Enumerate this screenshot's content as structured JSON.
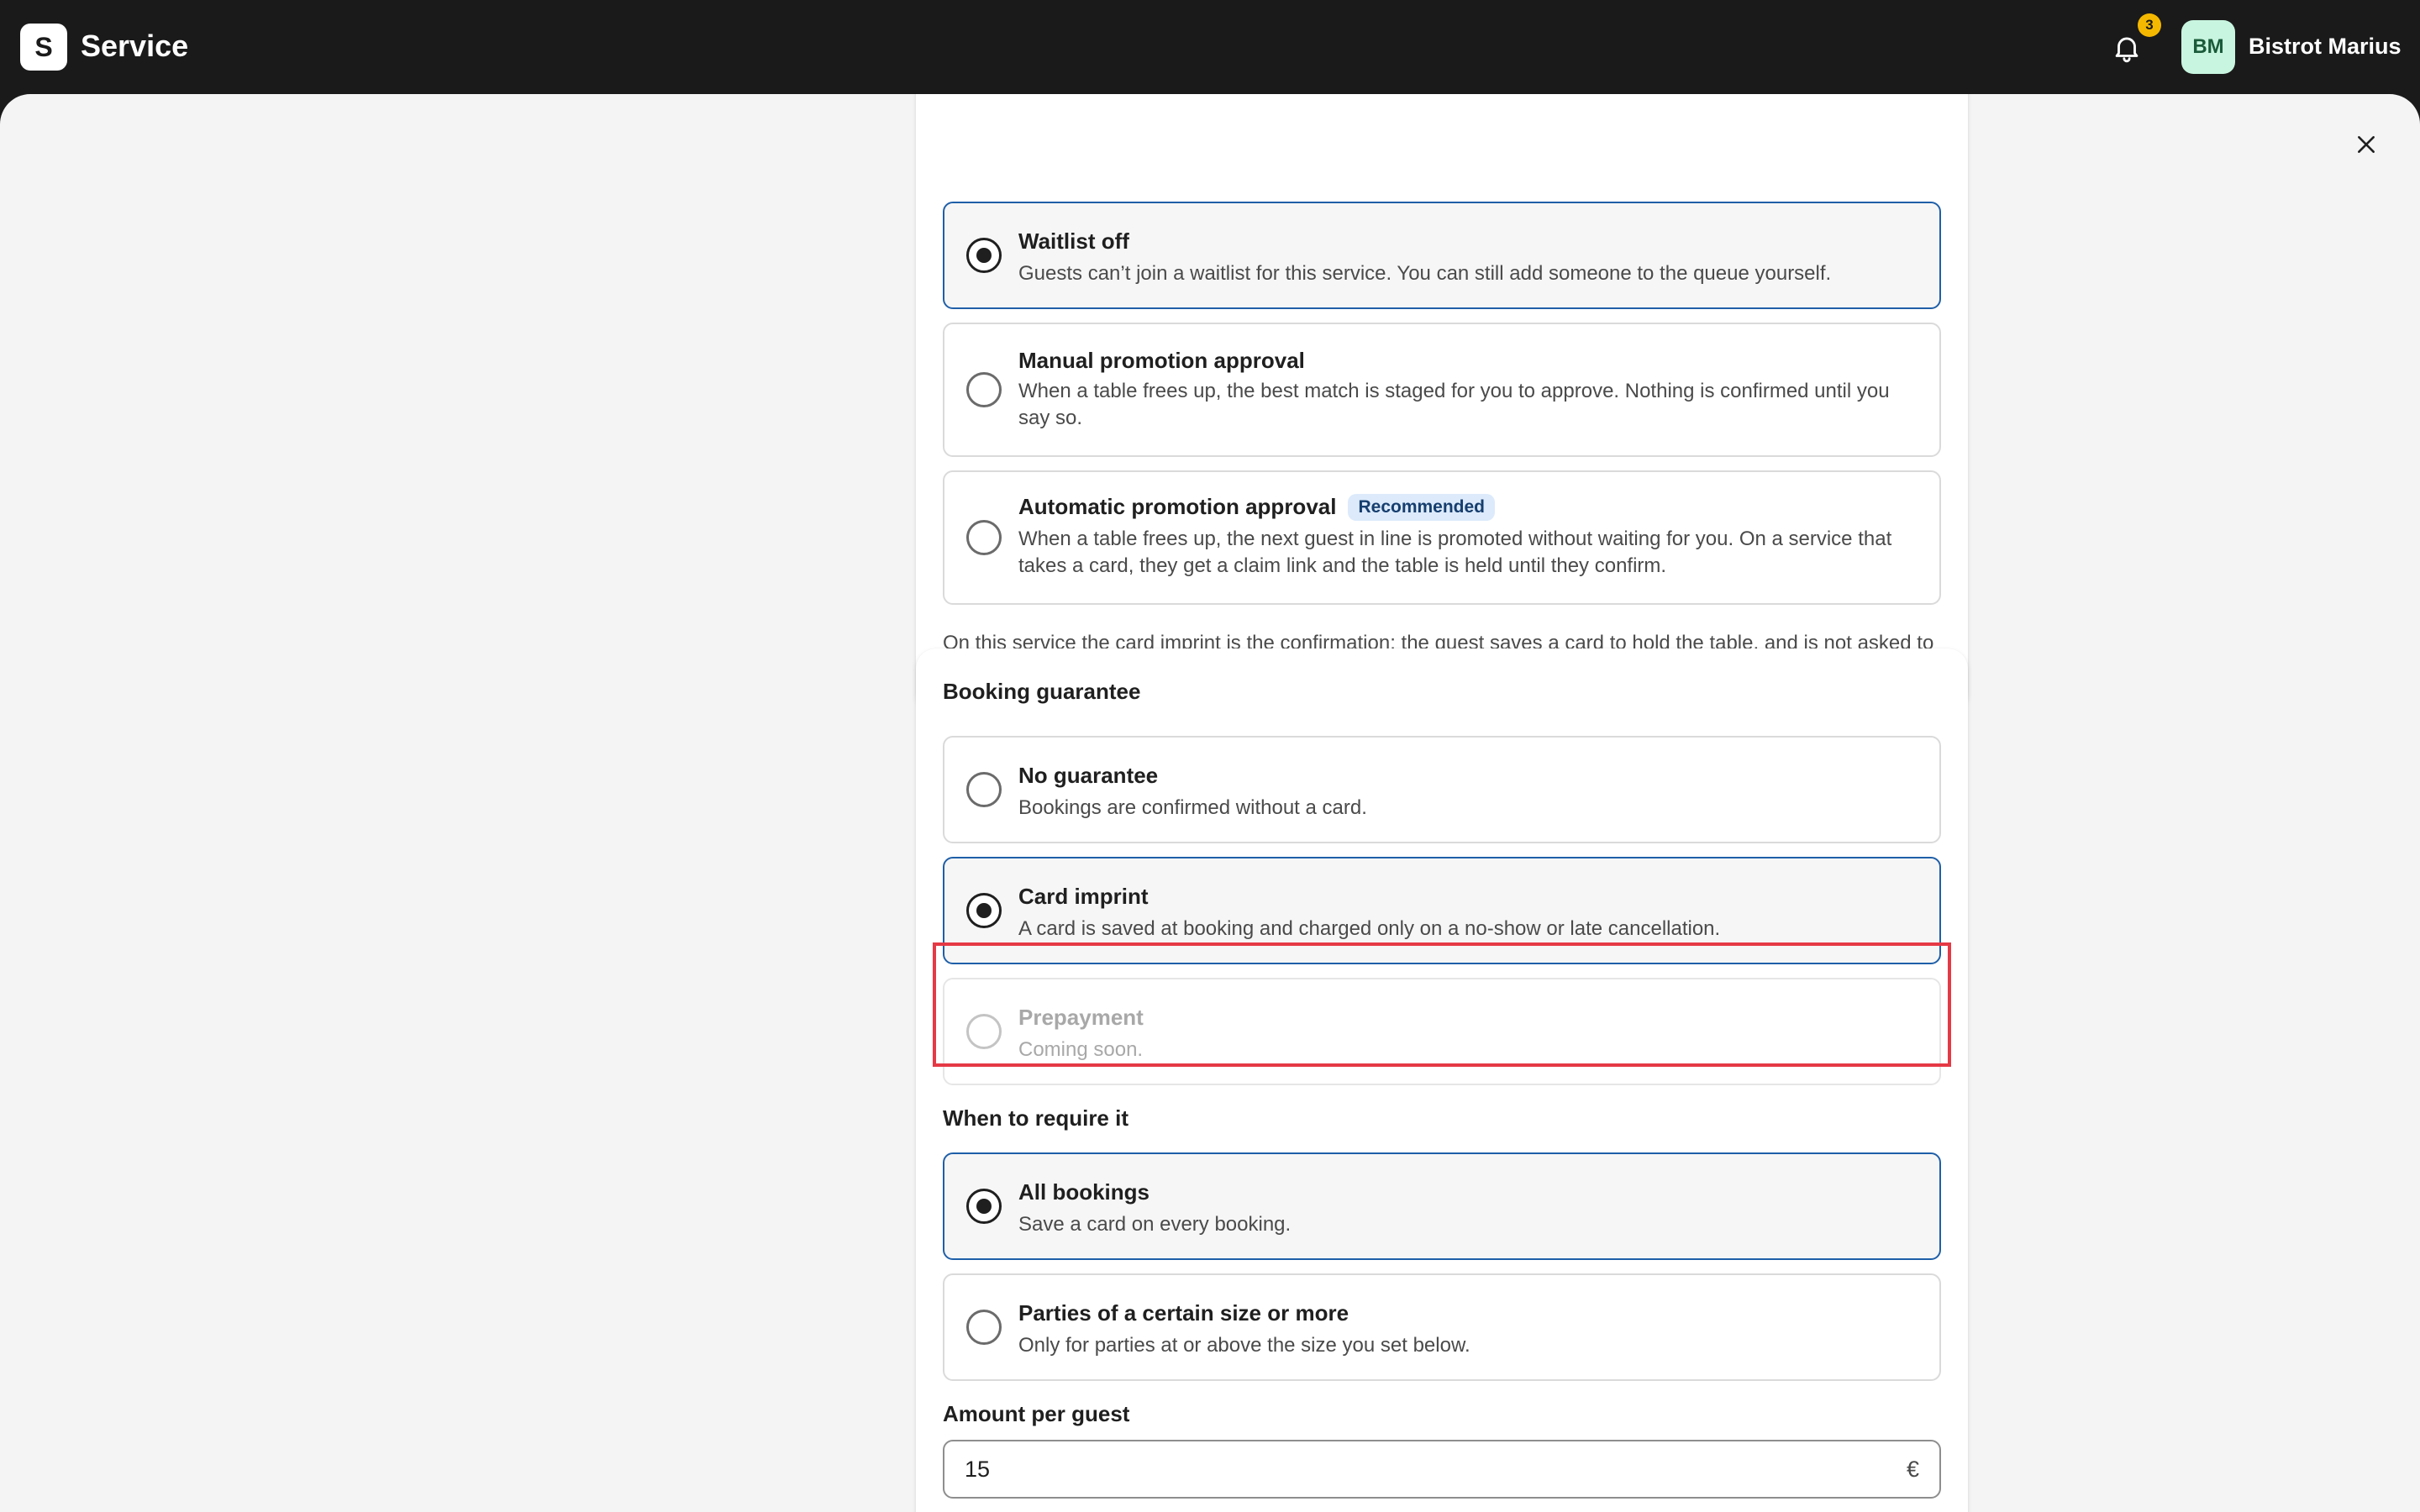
{
  "header": {
    "logo_letter": "S",
    "app_title": "Service",
    "notification_count": "3",
    "avatar_initials": "BM",
    "account_name": "Bistrot Marius"
  },
  "waitlist": {
    "options": [
      {
        "title": "Waitlist off",
        "description": "Guests can’t join a waitlist for this service. You can still add someone to the queue yourself.",
        "selected": true
      },
      {
        "title": "Manual promotion approval",
        "description": "When a table frees up, the best match is staged for you to approve. Nothing is confirmed until you say so.",
        "selected": false
      },
      {
        "title": "Automatic promotion approval",
        "badge": "Recommended",
        "description": "When a table frees up, the next guest in line is promoted without waiting for you. On a service that takes a card, they get a claim link and the table is held until they confirm.",
        "selected": false
      }
    ],
    "note": "On this service the card imprint is the confirmation: the guest saves a card to hold the table, and is not asked to confirm twice."
  },
  "guarantee": {
    "section_title": "Booking guarantee",
    "options": [
      {
        "title": "No guarantee",
        "description": "Bookings are confirmed without a card.",
        "selected": false
      },
      {
        "title": "Card imprint",
        "description": "A card is saved at booking and charged only on a no-show or late cancellation.",
        "selected": true
      },
      {
        "title": "Prepayment",
        "description": "Coming soon.",
        "selected": false,
        "disabled": true
      }
    ],
    "require_title": "When to require it",
    "require_options": [
      {
        "title": "All bookings",
        "description": "Save a card on every booking.",
        "selected": true
      },
      {
        "title": "Parties of a certain size or more",
        "description": "Only for parties at or above the size you set below.",
        "selected": false
      }
    ],
    "amount_label": "Amount per guest",
    "amount_value": "15",
    "amount_currency": "€"
  },
  "colors": {
    "topbar": "#1a1a1a",
    "selected_border": "#1f5fa8",
    "highlight": "#e53945",
    "badge_bg": "#dceafb",
    "notification_badge": "#f5b800"
  }
}
